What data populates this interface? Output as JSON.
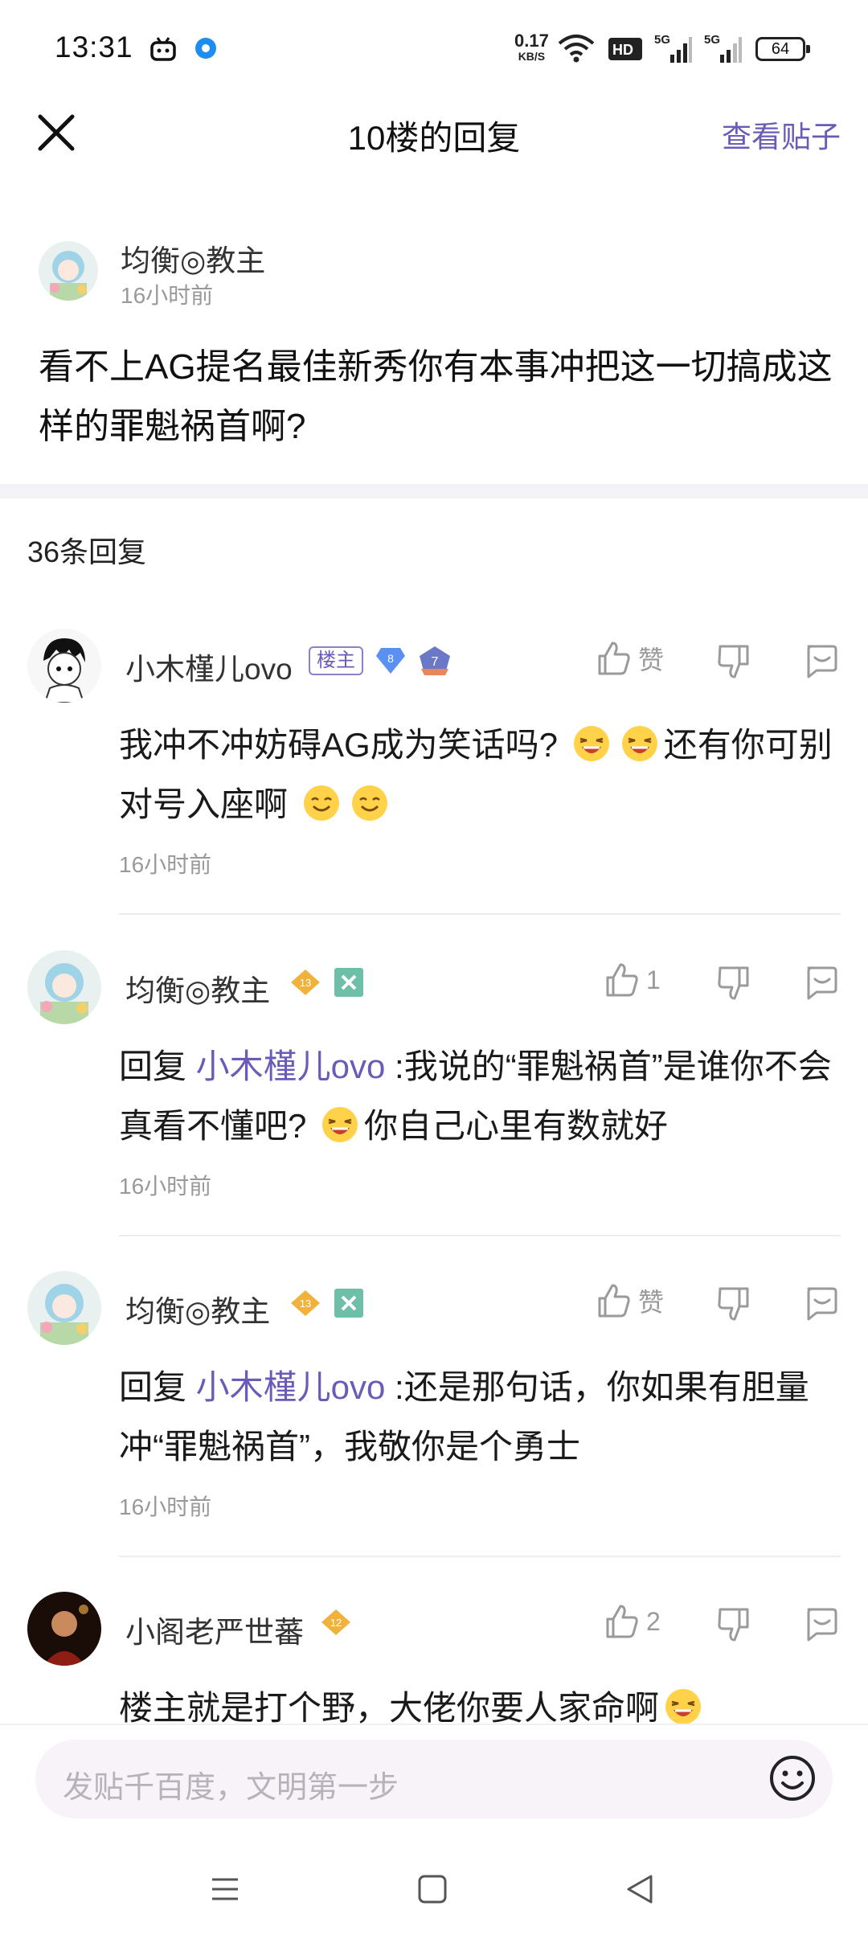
{
  "status_bar": {
    "time": "13:31",
    "net_speed_value": "0.17",
    "net_speed_unit": "KB/S",
    "battery": "64",
    "icons": [
      "bilibili-tv-icon",
      "blue-dot-icon",
      "wifi-icon",
      "hd-icon",
      "signal-5g-icon",
      "signal-5g-icon",
      "battery-icon"
    ]
  },
  "header": {
    "title": "10楼的回复",
    "view_post": "查看贴子"
  },
  "original_post": {
    "author": "均衡◎教主",
    "time": "16小时前",
    "content": "看不上AG提名最佳新秀你有本事冲把这一切搞成这样的罪魁祸首啊?"
  },
  "reply_count": "36条回复",
  "replies": [
    {
      "author": "小木槿儿ovo",
      "owner_badge": "楼主",
      "level": "8",
      "sub_level": "7",
      "likes": "赞",
      "content_a": "我冲不冲妨碍AG成为笑话吗?",
      "content_b": "还有你可别对号入座啊",
      "time": "16小时前"
    },
    {
      "author": "均衡◎教主",
      "level": "13",
      "likes": "1",
      "reply_prefix": "回复 ",
      "mention": "小木槿儿ovo",
      "content_a": " :我说的“罪魁祸首”是谁你不会真看不懂吧?",
      "content_b": "你自己心里有数就好",
      "time": "16小时前"
    },
    {
      "author": "均衡◎教主",
      "level": "13",
      "likes": "赞",
      "reply_prefix": "回复 ",
      "mention": "小木槿儿ovo",
      "content_a": " :还是那句话，你如果有胆量冲“罪魁祸首”，我敬你是个勇士",
      "time": "16小时前"
    },
    {
      "author": "小阁老严世蕃",
      "level": "12",
      "likes": "2",
      "content_a": "楼主就是打个野，大佬你要人家命啊"
    }
  ],
  "input": {
    "placeholder": "发贴千百度，文明第一步"
  },
  "colors": {
    "accent": "#6a5bb8",
    "muted": "#999999",
    "level_blue": "#5b8ff0",
    "level_gold": "#f0b23a",
    "badge_teal": "#6fbfa8"
  }
}
